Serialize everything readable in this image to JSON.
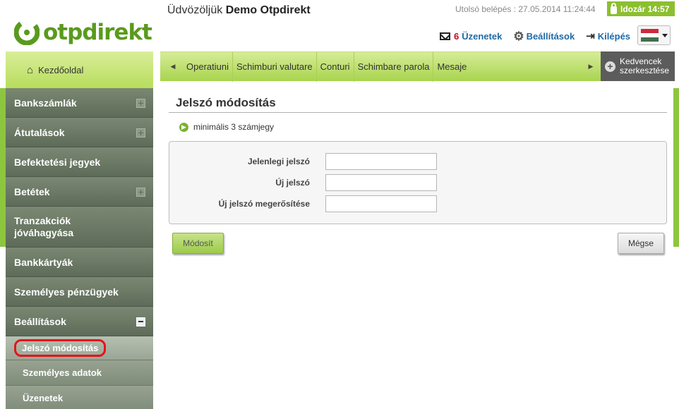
{
  "header": {
    "logo_text_a": "otp",
    "logo_text_b": "direkt",
    "welcome_prefix": "Üdvözöljük",
    "welcome_name": "Demo Otpdirekt",
    "last_login": "Utolsó belépés : 27.05.2014 11:24:44",
    "timer_label": "Idozár 14:57",
    "messages_count": "6",
    "messages_label": "Üzenetek",
    "settings_label": "Beállítások",
    "logout_label": "Kilépés",
    "language_flag": "hungary-flag"
  },
  "home": {
    "label": "Kezdőoldal"
  },
  "tabs": [
    {
      "label": "Operatiuni"
    },
    {
      "label": "Schimburi valutare"
    },
    {
      "label": "Conturi"
    },
    {
      "label": "Schimbare parola"
    },
    {
      "label": "Mesaje"
    }
  ],
  "favorites": {
    "label_line1": "Kedvencek",
    "label_line2": "szerkesztése"
  },
  "nav": {
    "items": [
      {
        "label": "Bankszámlák"
      },
      {
        "label": "Átutalások"
      },
      {
        "label": "Befektetési jegyek"
      },
      {
        "label": "Betétek"
      },
      {
        "label_line1": "Tranzakciók",
        "label_line2": "jóváhagyása"
      },
      {
        "label": "Bankkártyák"
      },
      {
        "label": "Személyes pénzügyek"
      },
      {
        "label": "Beállítások"
      }
    ],
    "subitems": [
      {
        "label": "Jelszó módosítás"
      },
      {
        "label": "Személyes adatok"
      },
      {
        "label": "Üzenetek"
      }
    ]
  },
  "main": {
    "title": "Jelszó módosítás",
    "hint": "minimális 3 számjegy",
    "fields": [
      {
        "label": "Jelenlegi jelszó",
        "value": ""
      },
      {
        "label": "Új jelszó",
        "value": ""
      },
      {
        "label": "Új jelszó megerősítése",
        "value": ""
      }
    ],
    "modify_button": "Módosít",
    "cancel_button": "Mégse"
  },
  "colors": {
    "brand_green": "#8cc63f",
    "nav_dark": "#5d6b58",
    "active_highlight": "#e3141c",
    "link_blue": "#1f6aa5",
    "flag": [
      "#cd2a3e",
      "#ffffff",
      "#436f4d"
    ]
  }
}
